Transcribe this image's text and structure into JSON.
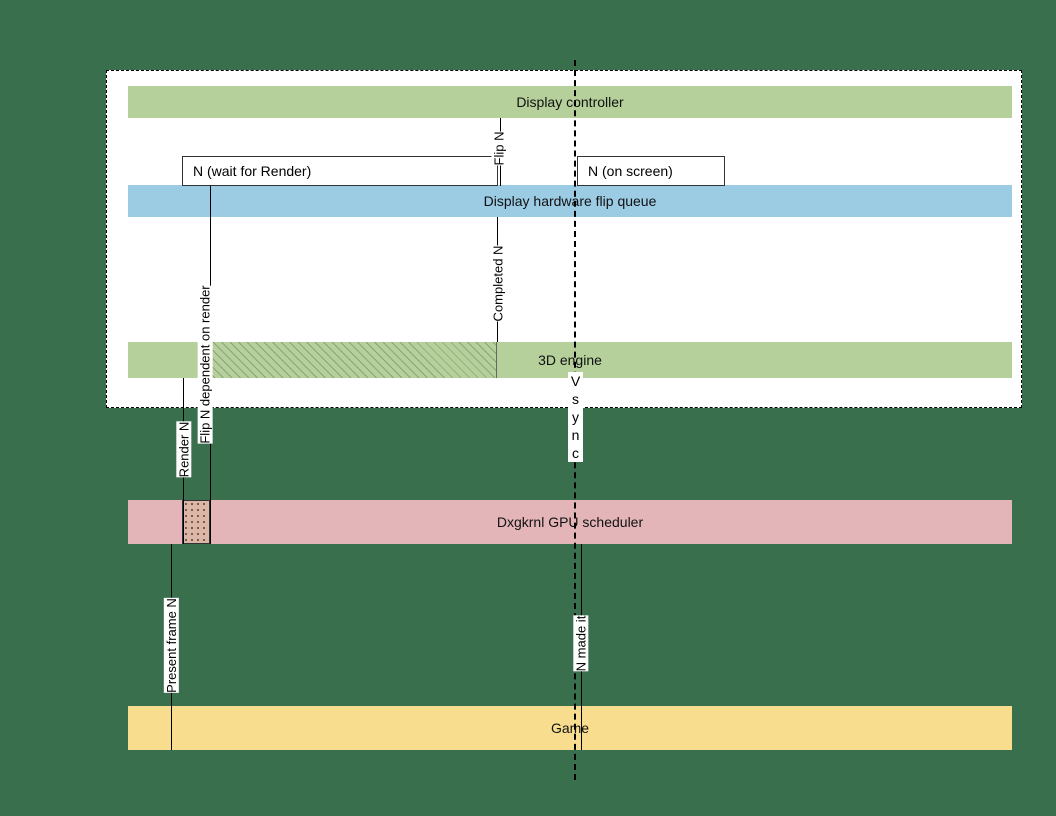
{
  "lanes": {
    "display_controller": "Display controller",
    "flip_queue": "Display hardware flip queue",
    "engine_3d": "3D engine",
    "scheduler": "Dxgkrnl GPU scheduler",
    "game": "Game"
  },
  "boxes": {
    "wait_render": "N (wait for Render)",
    "on_screen": "N (on screen)"
  },
  "vlabels": {
    "flip_n": "Flip N",
    "completed_n": "Completed N",
    "flip_dep": "Flip N dependent on render",
    "render_n": "Render N",
    "present_frame_n": "Present frame N",
    "n_made_it": "N made it"
  },
  "vsync": [
    "V",
    "s",
    "y",
    "n",
    "c"
  ]
}
